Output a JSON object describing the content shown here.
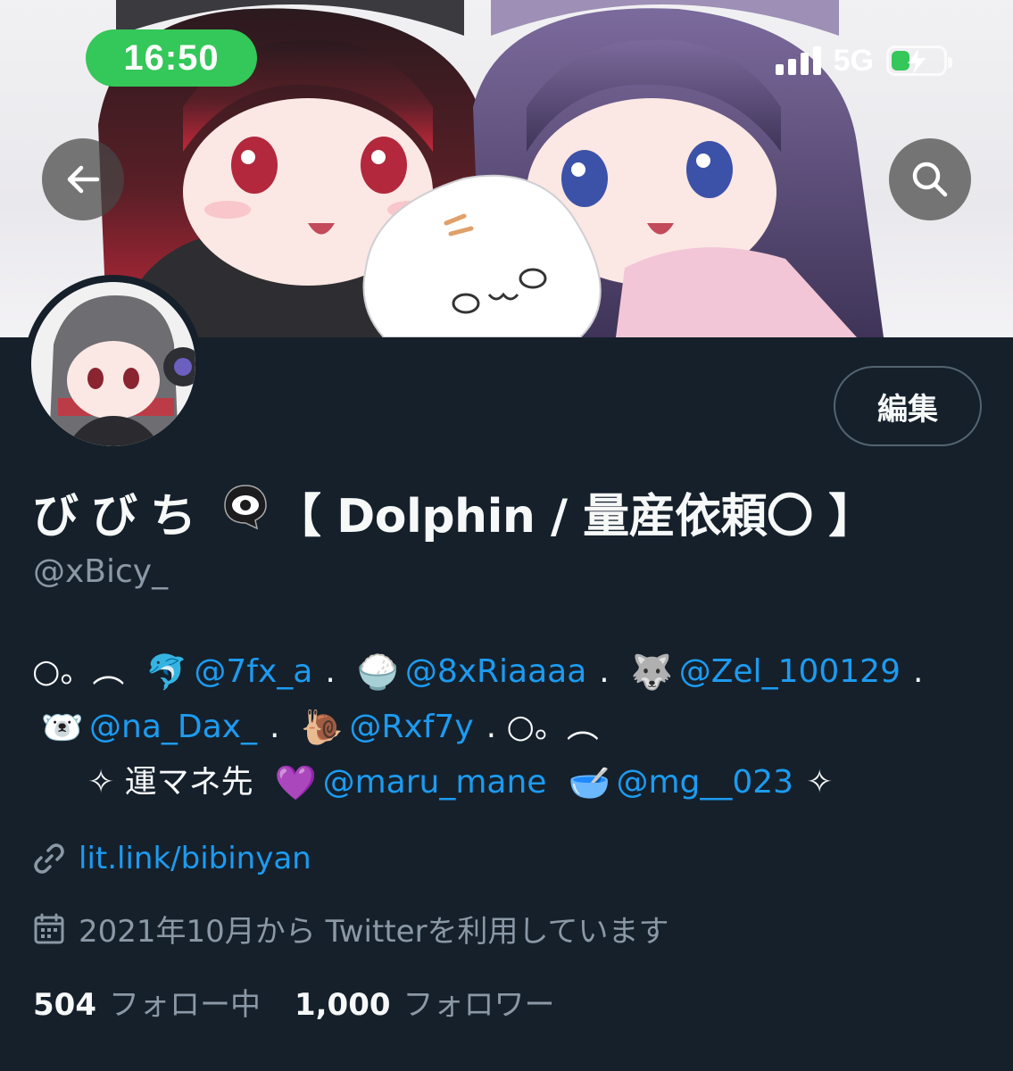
{
  "status_bar": {
    "time": "16:50",
    "network": "5G",
    "battery_level": 0.35,
    "signal_bars": 4,
    "accent": "#34c759"
  },
  "nav": {
    "back_icon": "arrow-left-icon",
    "search_icon": "search-icon"
  },
  "profile": {
    "display_name": "びびち",
    "name_emoji": "eye-in-speech-bubble-icon",
    "name_suffix": "【 Dolphin / 量産依頼〇 】",
    "handle": "@xBicy_",
    "edit_label": "編集"
  },
  "bio": {
    "line1": [
      {
        "type": "text",
        "value": "○。︵"
      },
      {
        "type": "emoji",
        "value": "🐬",
        "icon": "dolphin-icon"
      },
      {
        "type": "mention",
        "value": "@7fx_a"
      },
      {
        "type": "text",
        "value": "."
      },
      {
        "type": "emoji",
        "value": "🍚",
        "icon": "rice-bowl-icon"
      },
      {
        "type": "mention",
        "value": "@8xRiaaaa"
      },
      {
        "type": "text",
        "value": "."
      },
      {
        "type": "emoji",
        "value": "🐺",
        "icon": "wolf-icon"
      },
      {
        "type": "mention",
        "value": "@Zel_100129"
      },
      {
        "type": "text",
        "value": "."
      }
    ],
    "line2": [
      {
        "type": "emoji",
        "value": "🐻‍❄️",
        "icon": "polar-bear-icon"
      },
      {
        "type": "mention",
        "value": "@na_Dax_"
      },
      {
        "type": "text",
        "value": "."
      },
      {
        "type": "emoji",
        "value": "🐌",
        "icon": "snail-icon"
      },
      {
        "type": "mention",
        "value": "@Rxf7y"
      },
      {
        "type": "text",
        "value": ". ○。︵"
      }
    ],
    "line3": [
      {
        "type": "text",
        "value": "✧ 運マネ先"
      },
      {
        "type": "emoji",
        "value": "💜",
        "icon": "purple-heart-icon"
      },
      {
        "type": "mention",
        "value": "@maru_mane"
      },
      {
        "type": "emoji",
        "value": "🥣",
        "icon": "bowl-with-spoon-icon"
      },
      {
        "type": "mention",
        "value": "@mg__023"
      },
      {
        "type": "text",
        "value": "✧"
      }
    ]
  },
  "link": {
    "icon": "link-icon",
    "text": "lit.link/bibinyan"
  },
  "joined": {
    "icon": "calendar-icon",
    "text": "2021年10月から Twitterを利用しています"
  },
  "stats": {
    "following_count": "504",
    "following_label": "フォロー中",
    "followers_count": "1,000",
    "followers_label": "フォロワー"
  },
  "colors": {
    "background": "#15202b",
    "mention": "#1d9bf0",
    "secondary_text": "#8b98a5"
  }
}
